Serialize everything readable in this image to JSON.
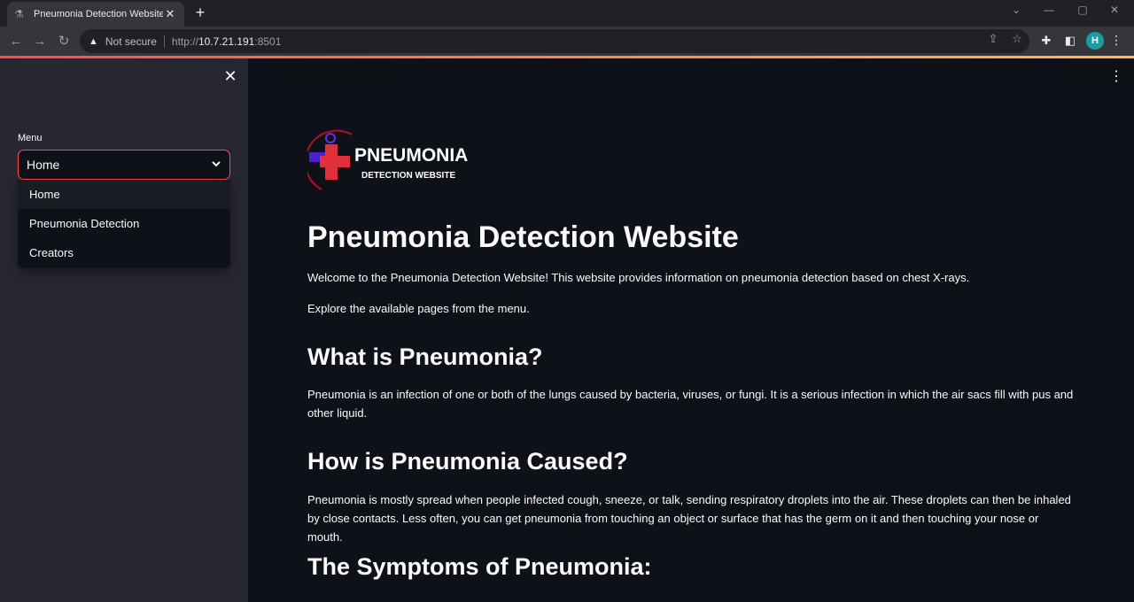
{
  "browser": {
    "tab_title": "Pneumonia Detection Website",
    "tab_close": "✕",
    "new_tab": "+",
    "security_label": "Not secure",
    "url_scheme": "http://",
    "url_host": "10.7.21.191",
    "url_port": ":8501",
    "avatar_letter": "H"
  },
  "sidebar": {
    "close": "✕",
    "menu_label": "Menu",
    "selected": "Home",
    "options": [
      "Home",
      "Pneumonia Detection",
      "Creators"
    ]
  },
  "logo": {
    "line1": "PNEUMONIA",
    "line2": "DETECTION WEBSITE"
  },
  "content": {
    "title": "Pneumonia Detection Website",
    "welcome": "Welcome to the Pneumonia Detection Website! This website provides information on pneumonia detection based on chest X-rays.",
    "explore": "Explore the available pages from the menu.",
    "what_heading": "What is Pneumonia?",
    "what_text": "Pneumonia is an infection of one or both of the lungs caused by bacteria, viruses, or fungi. It is a serious infection in which the air sacs fill with pus and other liquid.",
    "how_heading": "How is Pneumonia Caused?",
    "how_text": "Pneumonia is mostly spread when people infected cough, sneeze, or talk, sending respiratory droplets into the air. These droplets can then be inhaled by close contacts. Less often, you can get pneumonia from touching an object or surface that has the germ on it and then touching your nose or mouth.",
    "symptoms_heading": "The Symptoms of Pneumonia:"
  },
  "colors": {
    "accent": "#ff4b4b",
    "background": "#0e1117",
    "sidebar": "#262730"
  }
}
